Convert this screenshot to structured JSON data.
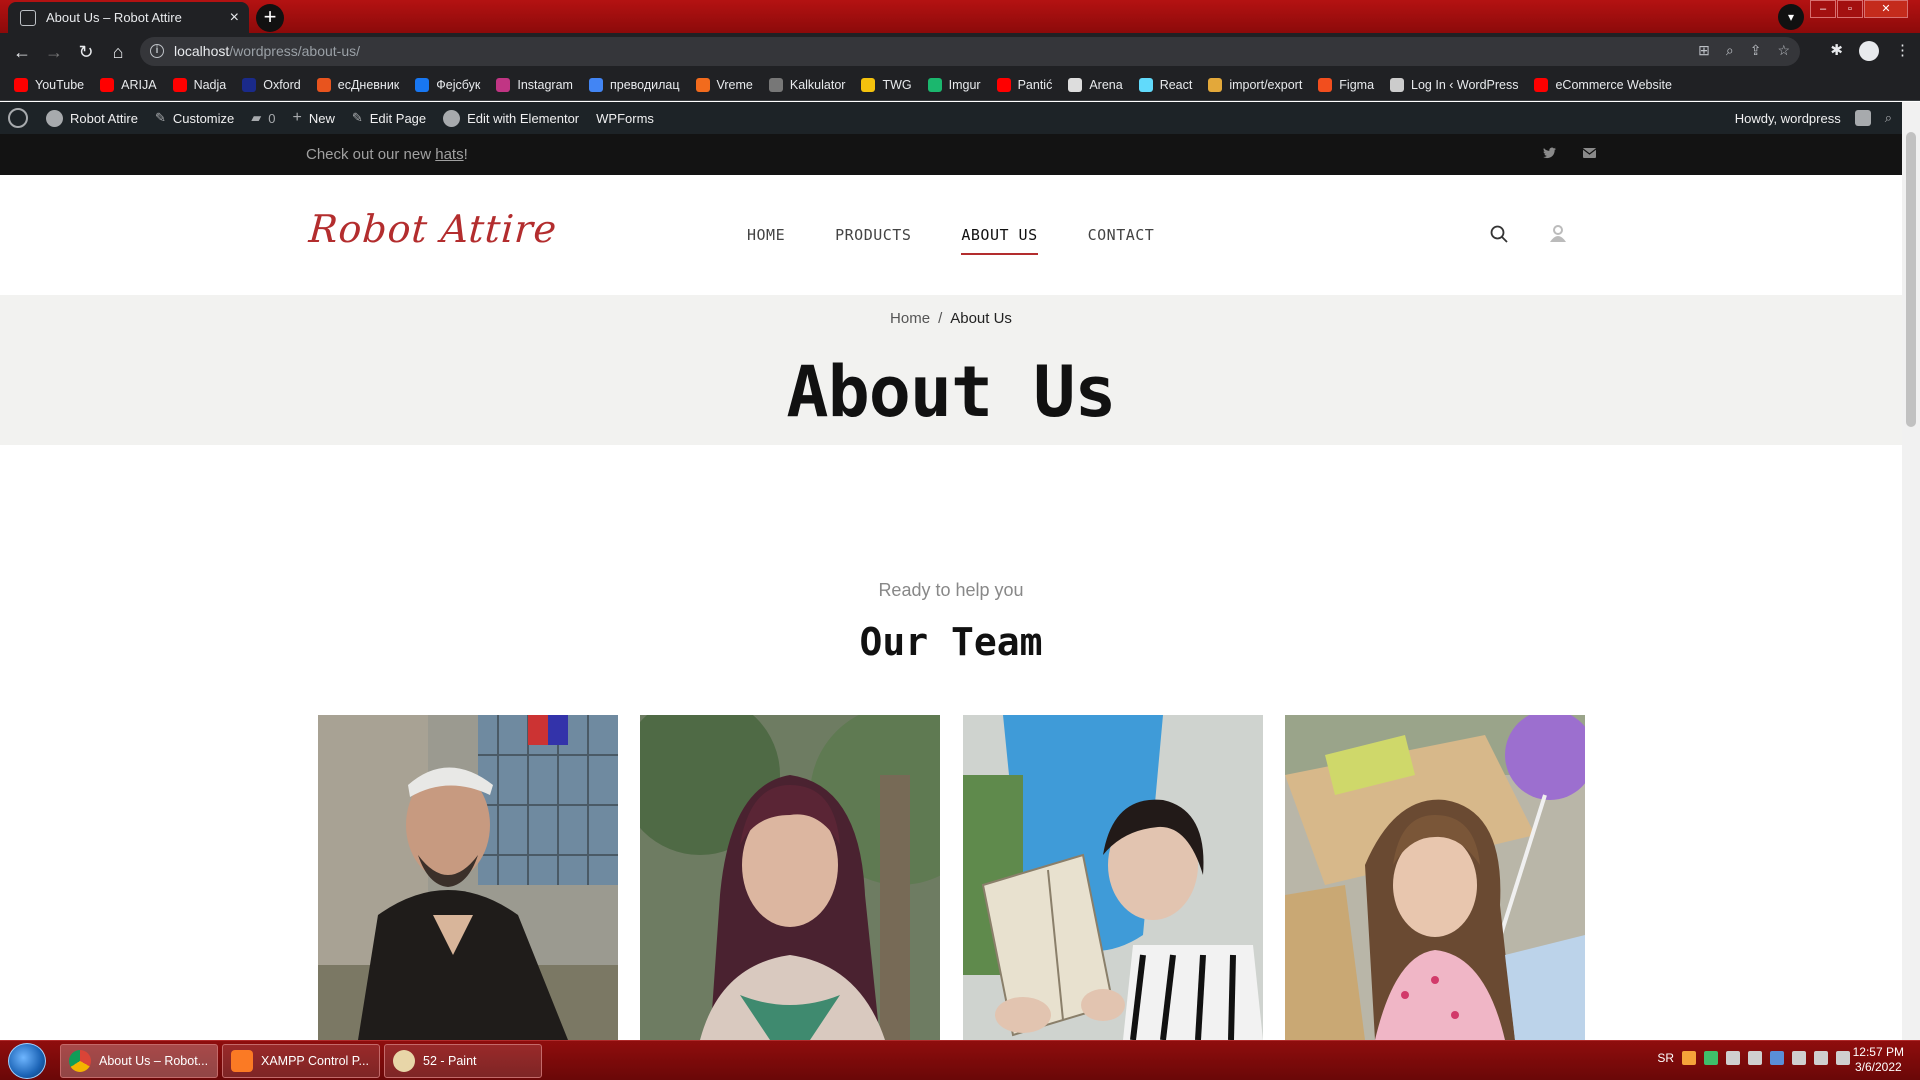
{
  "browser": {
    "tab_title": "About Us – Robot Attire",
    "tab_close": "×",
    "new_tab": "+",
    "url_host": "localhost",
    "url_path": "/wordpress/about-us/",
    "bookmarks": [
      {
        "label": "YouTube",
        "color": "#ff0000"
      },
      {
        "label": "ARIJA",
        "color": "#ff0000"
      },
      {
        "label": "Nadja",
        "color": "#ff0000"
      },
      {
        "label": "Oxford",
        "color": "#1a2a8a"
      },
      {
        "label": "есДневник",
        "color": "#e8541e"
      },
      {
        "label": "Фејсбук",
        "color": "#1877f2"
      },
      {
        "label": "Instagram",
        "color": "#c13584"
      },
      {
        "label": "преводилац",
        "color": "#4285f4"
      },
      {
        "label": "Vreme",
        "color": "#f26b1d"
      },
      {
        "label": "Kalkulator",
        "color": "#777777"
      },
      {
        "label": "TWG",
        "color": "#f4c20d"
      },
      {
        "label": "Imgur",
        "color": "#1bb76e"
      },
      {
        "label": "Pantić",
        "color": "#ff0000"
      },
      {
        "label": "Arena",
        "color": "#dddddd"
      },
      {
        "label": "React",
        "color": "#61dafb"
      },
      {
        "label": "import/export",
        "color": "#e3a83a"
      },
      {
        "label": "Figma",
        "color": "#f24e1e"
      },
      {
        "label": "Log In ‹ WordPress",
        "color": "#cccccc"
      },
      {
        "label": "eCommerce Website",
        "color": "#ff0000"
      }
    ]
  },
  "adminbar": {
    "site_name": "Robot Attire",
    "customize": "Customize",
    "comments_count": "0",
    "new": "New",
    "edit_page": "Edit Page",
    "edit_elementor": "Edit with Elementor",
    "wpforms": "WPForms",
    "howdy": "Howdy, wordpress"
  },
  "notice": {
    "text_before": "Check out our new ",
    "link": "hats",
    "text_after": "!"
  },
  "header": {
    "logo": "Robot Attire",
    "menu": [
      "HOME",
      "PRODUCTS",
      "ABOUT US",
      "CONTACT"
    ]
  },
  "title_band": {
    "crumb_home": "Home",
    "crumb_sep": "/",
    "crumb_current": "About Us",
    "title": "About Us"
  },
  "team": {
    "eyebrow": "Ready to help you",
    "title": "Our Team"
  },
  "taskbar": {
    "tasks": [
      "About Us – Robot...",
      "XAMPP Control P...",
      "52 - Paint"
    ],
    "lang": "SR",
    "time": "12:57 PM",
    "date": "3/6/2022"
  },
  "colors": {
    "accent": "#b32d2e",
    "admin_bar": "#1d2327",
    "chrome_frame": "#b41212"
  }
}
